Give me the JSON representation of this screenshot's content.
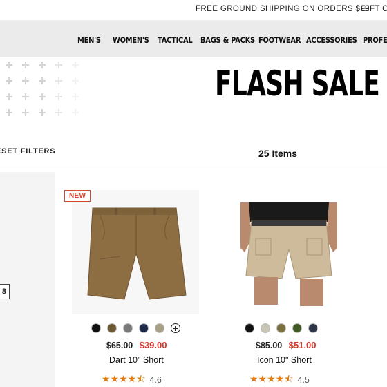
{
  "promo": {
    "shipping": "FREE GROUND SHIPPING ON ORDERS $99+",
    "gift": "GIFT CA"
  },
  "nav": {
    "items": [
      "MEN'S",
      "WOMEN'S",
      "TACTICAL",
      "BAGS & PACKS",
      "FOOTWEAR",
      "ACCESSORIES",
      "PROFES"
    ]
  },
  "hero": {
    "title": "FLASH SALE"
  },
  "filters": {
    "reset_label": "ESET FILTERS",
    "count": "25 Items"
  },
  "sidebar": {
    "size_chip": "8"
  },
  "colors": {
    "accent": "#d6352a",
    "star": "#e07b14",
    "badge": "#d9472e"
  },
  "products": [
    {
      "badge": "NEW",
      "swatches": [
        "#111111",
        "#6b5a34",
        "#7a7a7a",
        "#1c2a4a",
        "#a8a085"
      ],
      "more_swatches_icon": "plus-circle-icon",
      "price_old": "$65.00",
      "price_new": "$39.00",
      "name": "Dart 10\" Short",
      "stars": "★★★★⯪",
      "rating": "4.6"
    },
    {
      "badge": "",
      "swatches": [
        "#111111",
        "#c8c6b5",
        "#7a6f3e",
        "#3f5a25",
        "#2e3548"
      ],
      "price_old": "$85.00",
      "price_new": "$51.00",
      "name": "Icon 10\" Short",
      "stars": "★★★★⯪",
      "rating": "4.5"
    }
  ]
}
